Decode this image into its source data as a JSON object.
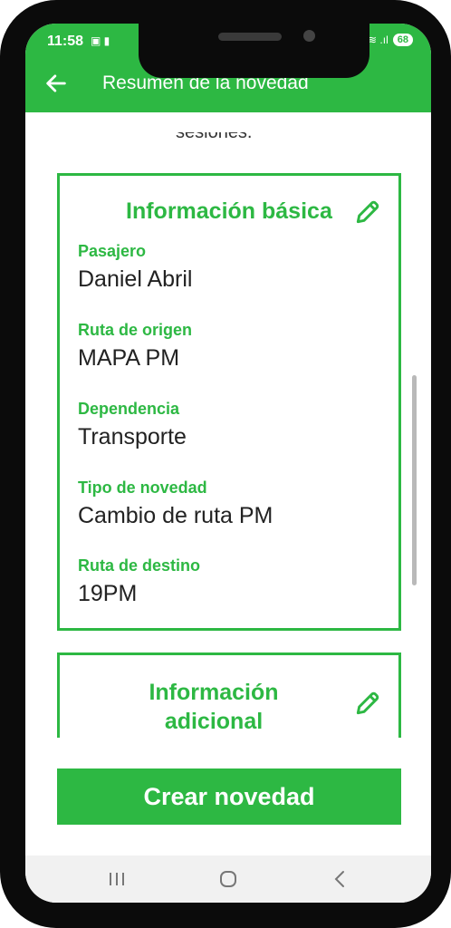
{
  "status_bar": {
    "time": "11:58",
    "left_icons": "▣ ▮",
    "battery": "68",
    "signal_text": "≋ .ıl"
  },
  "app_bar": {
    "title": "Resumen de la novedad",
    "back_icon": "arrow-left-icon"
  },
  "content": {
    "cut_text": "sesiones."
  },
  "basic_info": {
    "title": "Información básica",
    "fields": [
      {
        "label": "Pasajero",
        "value": "Daniel Abril"
      },
      {
        "label": "Ruta de origen",
        "value": "MAPA PM"
      },
      {
        "label": "Dependencia",
        "value": "Transporte"
      },
      {
        "label": "Tipo de novedad",
        "value": "Cambio de ruta PM"
      },
      {
        "label": "Ruta de destino",
        "value": "19PM"
      }
    ]
  },
  "additional_info": {
    "title": "Información adicional"
  },
  "actions": {
    "create_label": "Crear novedad"
  },
  "colors": {
    "brand_green": "#2db843"
  }
}
